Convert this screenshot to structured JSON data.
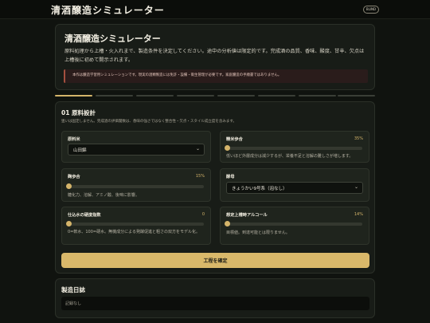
{
  "header": {
    "app_title": "清酒醸造シミュレーター",
    "blind_badge": "BLIND"
  },
  "hero": {
    "title": "清酒醸造シミュレーター",
    "description": "原料処理から上槽・火入れまで、製造条件を決定してください。途中の分析値は限定的です。完成酒の品質、香味、酸度、甘辛、欠点は上槽後に初めて開示されます。",
    "notice": "本作は醸造学習用シミュレーションです。現実の酒類製造には免許・設備・衛生管理が必要です。家庭醸造の手順書ではありません。"
  },
  "progress": {
    "total_steps": 8,
    "current_step": 1
  },
  "section": {
    "title": "01 原料設計",
    "subtitle": "狙いは固定しません。完成酒の評価閾数は、香味の強さではなく整合性・欠点・スタイル成立度を含みます。",
    "params": {
      "rice": {
        "label": "原料米",
        "value": "山田錦"
      },
      "polish": {
        "label": "精米歩合",
        "value": "35%",
        "fraction": 0.0,
        "hint": "低いほど外層成分は減少するが、栄養不足と溶解の難しさが増します。"
      },
      "koji": {
        "label": "麹歩合",
        "value": "15%",
        "fraction": 0.0,
        "hint": "糖化力、溶解、アミノ酸、後味に影響。"
      },
      "yeast": {
        "label": "酵母",
        "value": "きょうかい9号系（泡なし）"
      },
      "water": {
        "label": "仕込水の硬度指数",
        "value": "0",
        "fraction": 0.0,
        "hint": "0=軟水、100=硬水。無機成分による発酵促進と粗さの双方をモデル化。"
      },
      "alcohol": {
        "label": "想定上槽時アルコール",
        "value": "14%",
        "fraction": 0.0,
        "hint": "目標値。到達可能とは限りません。"
      }
    },
    "confirm_label": "工程を確定"
  },
  "log": {
    "title": "製造日誌",
    "empty": "記録なし"
  },
  "colors": {
    "accent": "#d4b46a",
    "background": "#10130f",
    "card": "#181c17",
    "warning": "#a5503f"
  }
}
